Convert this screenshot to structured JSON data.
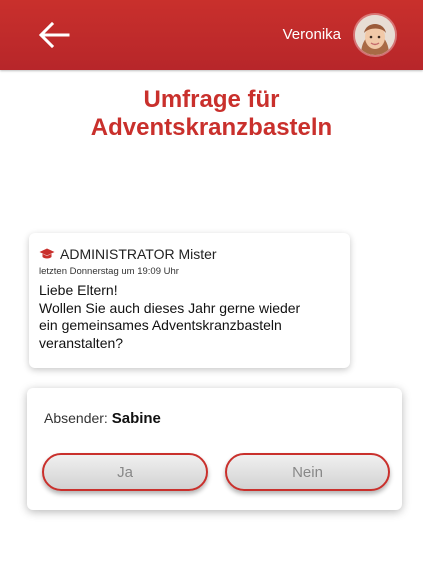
{
  "header": {
    "back_icon": "arrow-left-icon",
    "user_name": "Veronika",
    "avatar": "user-avatar",
    "background_color": "#c9302c"
  },
  "page": {
    "title_line1": "Umfrage für",
    "title_line2": "Adventskranzbasteln",
    "title_color": "#c9302c"
  },
  "message": {
    "sender_icon": "graduation-cap-icon",
    "sender": "ADMINISTRATOR Mister",
    "timestamp": "letzten Donnerstag um 19:09 Uhr",
    "body_line1": "Liebe Eltern!",
    "body_line2": "Wollen Sie auch dieses Jahr gerne wieder",
    "body_line3": "ein gemeinsames Adventskranzbasteln",
    "body_line4": "veranstalten?"
  },
  "response": {
    "absender_label": "Absender:",
    "absender_name": "Sabine",
    "yes_label": "Ja",
    "no_label": "Nein"
  }
}
